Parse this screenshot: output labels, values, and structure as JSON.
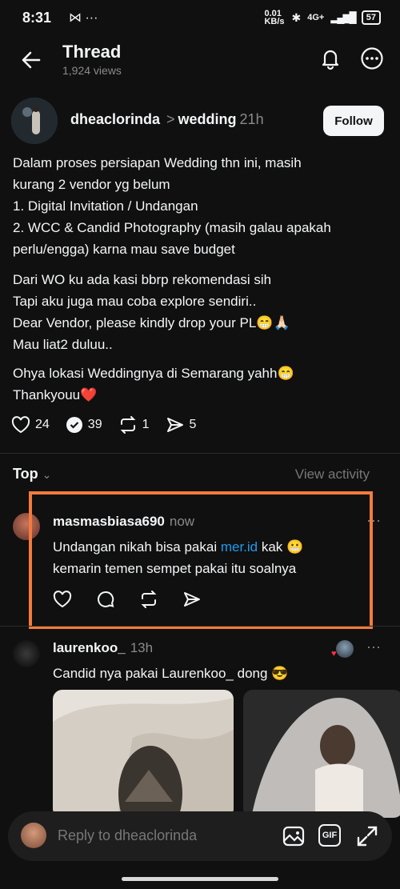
{
  "status": {
    "time": "8:31",
    "net_speed": "0.01 KB/s",
    "signal": "4G+",
    "battery": "57"
  },
  "header": {
    "title": "Thread",
    "views": "1,924 views"
  },
  "post": {
    "author": "dheaclorinda",
    "separator": ">",
    "topic": "wedding",
    "age": "21h",
    "follow_label": "Follow",
    "paragraphs": [
      "Dalam proses persiapan Wedding thn ini, masih\nkurang 2 vendor yg belum\n1. Digital Invitation / Undangan\n2. WCC & Candid Photography (masih galau apakah\nperlu/engga) karna mau save budget",
      "Dari WO ku ada kasi bbrp rekomendasi sih\nTapi aku juga mau coba explore sendiri..\nDear Vendor, please kindly drop your PL😁🙏🏻\nMau liat2 duluu..",
      "Ohya lokasi Weddingnya di Semarang yahh😁\nThankyouu❤️"
    ],
    "likes": "24",
    "replies": "39",
    "reposts": "1",
    "shares": "5"
  },
  "sort": {
    "label": "Top",
    "view_activity": "View activity"
  },
  "replies": [
    {
      "username": "masmasbiasa690",
      "age": "now",
      "text_before": "Undangan nikah bisa pakai ",
      "link": "mer.id",
      "text_after": " kak 😬\nkemarin temen sempet pakai itu soalnya"
    },
    {
      "username": "laurenkoo_",
      "age": "13h",
      "text": "Candid nya pakai Laurenkoo_ dong 😎"
    }
  ],
  "reply_bar": {
    "placeholder": "Reply to dheaclorinda",
    "gif_label": "GIF"
  },
  "colors": {
    "accent": "#f47b3c",
    "link": "#1d9bf0",
    "liked": "#ff3040"
  }
}
